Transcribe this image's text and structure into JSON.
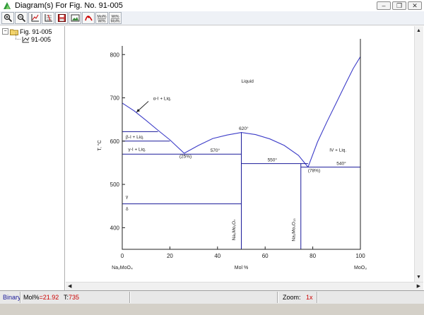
{
  "window": {
    "title": "Diagram(s) For Fig. No. 91-005",
    "minimize": "–",
    "restore": "❐",
    "close": "✕"
  },
  "toolbar": {
    "buttons": [
      {
        "icon": "zoom-in-icon"
      },
      {
        "icon": "zoom-out-icon"
      },
      {
        "icon": "axis-scale-icon"
      },
      {
        "icon": "grid-icon"
      },
      {
        "icon": "save-icon"
      },
      {
        "icon": "image-icon"
      },
      {
        "icon": "plot-icon"
      },
      {
        "icon": "mole-percent-icon",
        "label": "Mol%\nWt%"
      },
      {
        "icon": "weight-percent-icon",
        "label": "Wt%\nMol%"
      }
    ]
  },
  "tree": {
    "root": "Fig. 91-005",
    "child": "91-005",
    "expand_symbol": "−"
  },
  "chart_data": {
    "type": "phase-diagram",
    "xlim": [
      0,
      100
    ],
    "ylim": [
      350,
      820
    ],
    "xticks": [
      0,
      20,
      40,
      60,
      80,
      100
    ],
    "yticks": [
      400,
      500,
      600,
      700,
      800
    ],
    "xlabel": "Mol %",
    "ylabel": "T, °C",
    "x_end_labels": {
      "left": "Na₂MoO₄",
      "right": "MoO₃"
    },
    "liquidus": [
      [
        [
          0,
          688
        ],
        [
          5,
          670
        ],
        [
          10,
          648
        ],
        [
          15,
          625
        ],
        [
          20,
          603
        ],
        [
          26,
          572
        ]
      ],
      [
        [
          26,
          572
        ],
        [
          32,
          590
        ],
        [
          38,
          606
        ],
        [
          44,
          614
        ],
        [
          50,
          620
        ],
        [
          56,
          615
        ],
        [
          62,
          605
        ],
        [
          68,
          590
        ],
        [
          74,
          567
        ],
        [
          78,
          540
        ]
      ],
      [
        [
          78,
          540
        ],
        [
          82,
          598
        ],
        [
          86,
          645
        ],
        [
          90,
          690
        ],
        [
          94,
          735
        ],
        [
          97,
          768
        ],
        [
          100,
          795
        ]
      ]
    ],
    "isotherms": [
      {
        "x": [
          0,
          15
        ],
        "y": 622
      },
      {
        "x": [
          0,
          20
        ],
        "y": 600
      },
      {
        "x": [
          0,
          50
        ],
        "y": 570
      },
      {
        "x": [
          50,
          78
        ],
        "y": 548
      },
      {
        "x": [
          75,
          100
        ],
        "y": 540
      },
      {
        "x": [
          0,
          50
        ],
        "y": 455
      }
    ],
    "verticals": [
      {
        "x": 50,
        "y": [
          350,
          620
        ]
      },
      {
        "x": 75,
        "y": [
          350,
          548
        ]
      }
    ],
    "labels": [
      {
        "text": "Liquid",
        "x": 50,
        "y": 735
      },
      {
        "text": "α-I + Liq.",
        "x": 13,
        "y": 695
      },
      {
        "text": "β-I + Liq.",
        "x": 1.5,
        "y": 606
      },
      {
        "text": "γ-I + Liq.",
        "x": 2.5,
        "y": 578
      },
      {
        "text": "γ",
        "x": 1.5,
        "y": 468
      },
      {
        "text": "δ",
        "x": 1.5,
        "y": 440
      },
      {
        "text": "620°",
        "x": 49,
        "y": 626
      },
      {
        "text": "570°",
        "x": 37,
        "y": 575
      },
      {
        "text": "550°",
        "x": 61,
        "y": 553
      },
      {
        "text": "540°",
        "x": 90,
        "y": 545
      },
      {
        "text": "(25%)",
        "x": 24,
        "y": 561
      },
      {
        "text": "(78%)",
        "x": 78,
        "y": 529
      },
      {
        "text": "IV + Liq.",
        "x": 87,
        "y": 576
      },
      {
        "text": "Na₂Mo₂O₇",
        "x": 47.5,
        "y": 395,
        "rotate": true
      },
      {
        "text": "Na₂Mo₄O₁₃",
        "x": 72.5,
        "y": 395,
        "rotate": true
      }
    ],
    "arrow": {
      "from": [
        11,
        692
      ],
      "to": [
        6,
        667
      ]
    }
  },
  "status": {
    "system": "Binary",
    "mol_label": "Mol%",
    "mol_value": "=21.92",
    "t_label": "T:",
    "t_value": "735",
    "zoom_label": "Zoom:",
    "zoom_value": "1x"
  },
  "colors": {
    "curve": "#3c3cc8",
    "line": "#1a1a9a",
    "red": "#cc0000"
  }
}
